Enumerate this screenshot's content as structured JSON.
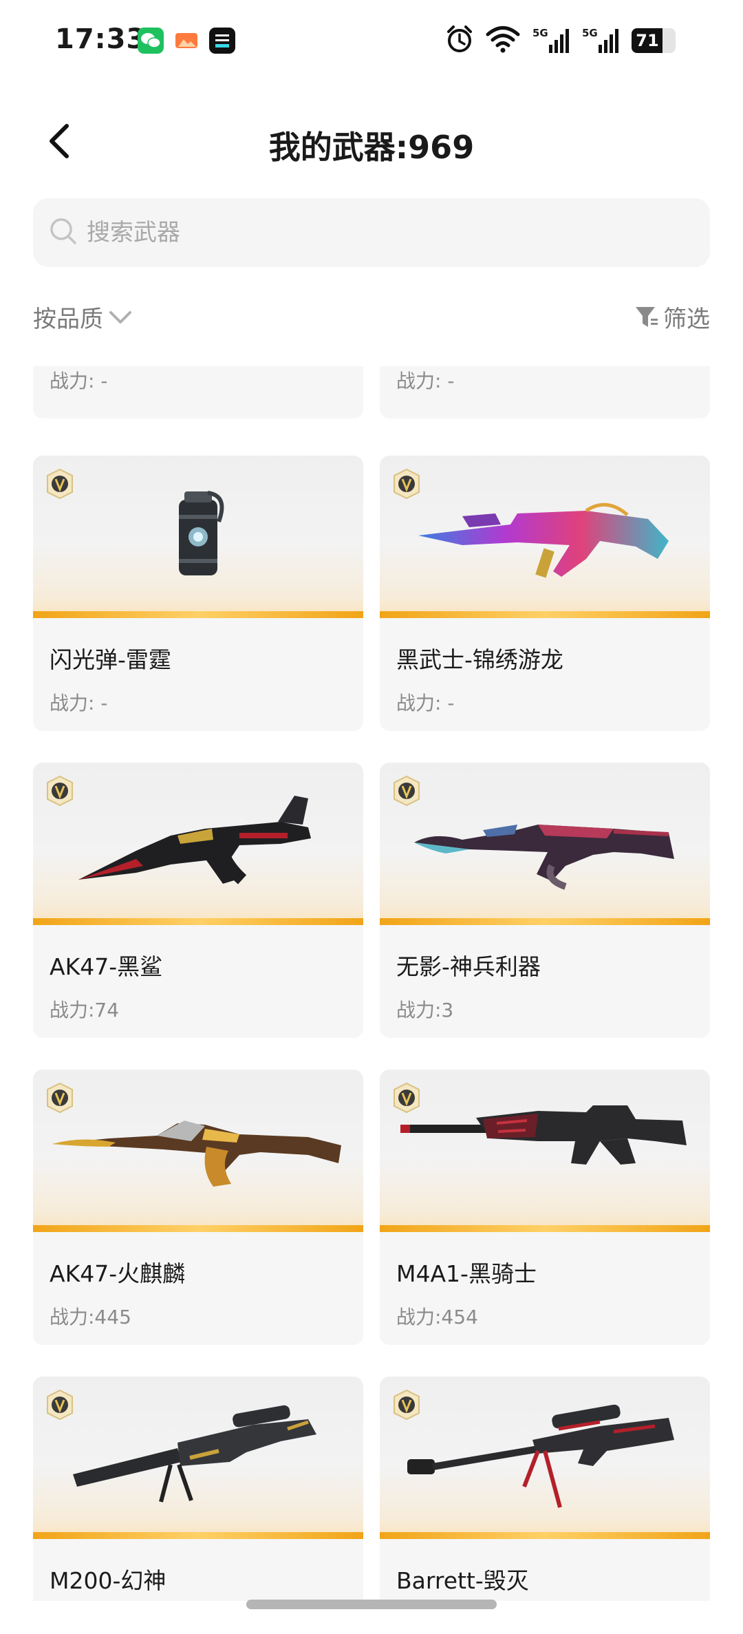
{
  "status_bar": {
    "time": "17:33",
    "notifications": [
      "wechat-icon",
      "photo-icon",
      "dewu-icon"
    ],
    "signal_1": "5G",
    "signal_2": "5G",
    "battery": "71",
    "battery_level": 0.71
  },
  "header": {
    "title": "我的武器:969"
  },
  "search": {
    "placeholder": "搜索武器"
  },
  "filters": {
    "sort_label": "按品质",
    "filter_label": "筛选"
  },
  "colors": {
    "accent_orange": "#f1a417",
    "badge_gold": "#c9a24a",
    "muted_text": "#8a8a8a"
  },
  "weapons": [
    {
      "name": "",
      "power": "战力: -",
      "icon": "partial-card"
    },
    {
      "name": "",
      "power": "战力: -",
      "icon": "partial-card"
    },
    {
      "name": "闪光弹-雷霆",
      "power": "战力: -",
      "icon": "flashbang-icon"
    },
    {
      "name": "黑武士-锦绣游龙",
      "power": "战力: -",
      "icon": "rifle-icon"
    },
    {
      "name": "AK47-黑鲨",
      "power": "战力:74",
      "icon": "rifle-icon"
    },
    {
      "name": "无影-神兵利器",
      "power": "战力:3",
      "icon": "rifle-icon"
    },
    {
      "name": "AK47-火麒麟",
      "power": "战力:445",
      "icon": "rifle-icon"
    },
    {
      "name": "M4A1-黑骑士",
      "power": "战力:454",
      "icon": "rifle-icon"
    },
    {
      "name": "M200-幻神",
      "power": "",
      "icon": "sniper-icon"
    },
    {
      "name": "Barrett-毁灭",
      "power": "",
      "icon": "sniper-icon"
    }
  ]
}
